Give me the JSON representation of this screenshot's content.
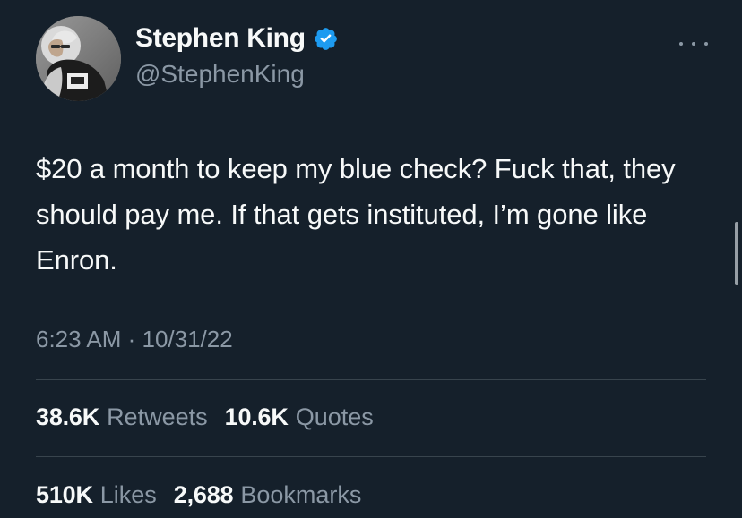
{
  "tweet": {
    "author": {
      "display_name": "Stephen King",
      "handle": "@StephenKing",
      "verified_icon": "verified-badge-icon",
      "avatar_icon": "avatar-photo-icon"
    },
    "text": "$20 a month to keep my blue check? Fuck that, they should pay me. If that gets instituted, I’m gone like Enron.",
    "timestamp": "6:23 AM · 10/31/22",
    "stats": {
      "retweets": {
        "value": "38.6K",
        "label": "Retweets"
      },
      "quotes": {
        "value": "10.6K",
        "label": "Quotes"
      },
      "likes": {
        "value": "510K",
        "label": "Likes"
      },
      "bookmarks": {
        "value": "2,688",
        "label": "Bookmarks"
      }
    }
  },
  "ui": {
    "more_icon": "more-horizontal-icon",
    "colors": {
      "background": "#15202b",
      "primary_text": "#f7f9f9",
      "secondary_text": "#8b98a5",
      "divider": "#38444d",
      "verified_blue": "#1d9bf0"
    }
  }
}
